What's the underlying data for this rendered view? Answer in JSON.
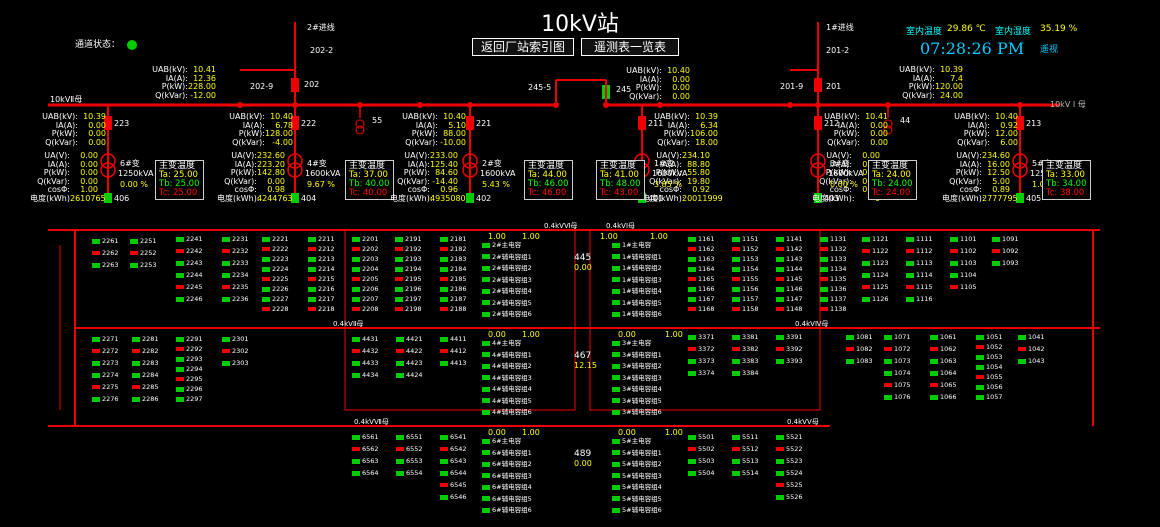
{
  "header": {
    "title": "10kV站",
    "channel_label": "通道状态：",
    "btn_back": "返回厂站索引图",
    "btn_tele": "遥测表一览表",
    "indoor_temp_label": "室内温度",
    "indoor_temp": "29.86 ℃",
    "indoor_hum_label": "室内湿度",
    "indoor_hum": "35.19 %",
    "time": "07:28:26 PM",
    "mode": "遥视"
  },
  "colors": {
    "busbar": "#e00000",
    "closed": "#00cc00",
    "text_value": "#ffff00"
  },
  "lines": {
    "in2": "2#进线",
    "in1": "1#进线",
    "b2022": "202-2",
    "b2012": "201-2",
    "b202": "202",
    "b2029": "202-9",
    "b201": "201",
    "b2019": "201-9",
    "b245": "245",
    "b2455": "245-5",
    "bus2": "10kVⅡ母",
    "bus1": "10kV I 母"
  },
  "incomer_left": {
    "rows": [
      [
        "UAB(kV):",
        "10.41"
      ],
      [
        "IA(A):",
        "12.36"
      ],
      [
        "P(kW):",
        "228.00"
      ],
      [
        "Q(kVar):",
        "-12.00"
      ]
    ]
  },
  "incomer_right": {
    "rows": [
      [
        "UAB(kV):",
        "10.39"
      ],
      [
        "IA(A):",
        "7.4"
      ],
      [
        "P(kW):",
        "120.00"
      ],
      [
        "Q(kVar):",
        "24.00"
      ]
    ]
  },
  "tie": {
    "rows": [
      [
        "UAB(kV):",
        "10.40"
      ],
      [
        "IA(A):",
        "0.00"
      ],
      [
        "P(kW):",
        "0.00"
      ],
      [
        "Q(kVar):",
        "0.00"
      ]
    ]
  },
  "feeders": [
    {
      "id": "223",
      "rows": [
        [
          "UAB(kV):",
          "10.39"
        ],
        [
          "IA(A):",
          "0.00"
        ],
        [
          "P(kW):",
          "0.00"
        ],
        [
          "Q(kVar):",
          "0.00"
        ]
      ],
      "rows2": [
        [
          "UA(V):",
          "0.00"
        ],
        [
          "IA(A):",
          "0.00"
        ],
        [
          "P(kW):",
          "0.00"
        ],
        [
          "Q(kVar):",
          "0.00"
        ],
        [
          "cosΦ:",
          "1.00"
        ],
        [
          "电度(kWh)",
          "2610765"
        ]
      ],
      "xf": "6#变",
      "kva": "1250kVA",
      "load": "0.00 %",
      "low": "406",
      "ta": "25.00",
      "tb": "25.00",
      "tc": "25.00"
    },
    {
      "id": "222",
      "rows": [
        [
          "UAB(kV):",
          "10.40"
        ],
        [
          "IA(A):",
          "6.78"
        ],
        [
          "P(kW):",
          "128.00"
        ],
        [
          "Q(kVar):",
          "-4.00"
        ]
      ],
      "rows2": [
        [
          "UA(V):",
          "232.60"
        ],
        [
          "IA(A):",
          "223.20"
        ],
        [
          "P(kW):",
          "142.80"
        ],
        [
          "Q(kVar):",
          "0.00"
        ],
        [
          "cosΦ:",
          "0.98"
        ],
        [
          "电度(kWh):",
          "4244763"
        ]
      ],
      "xf": "4#变",
      "kva": "1600kVA",
      "load": "9.67 %",
      "low": "404",
      "ta": "37.00",
      "tb": "40.00",
      "tc": "40.00"
    },
    {
      "id": "221",
      "rows": [
        [
          "UAB(kV):",
          "10.40"
        ],
        [
          "IA(A):",
          "5.10"
        ],
        [
          "P(kW):",
          "88.00"
        ],
        [
          "Q(kVar):",
          "-10.00"
        ]
      ],
      "rows2": [
        [
          "UA(V):",
          "233.00"
        ],
        [
          "IA(A):",
          "125.40"
        ],
        [
          "P(kW):",
          "84.60"
        ],
        [
          "Q(kVar):",
          "-14.40"
        ],
        [
          "cosΦ:",
          "0.96"
        ],
        [
          "电度(kWh):",
          "4935080"
        ]
      ],
      "xf": "2#变",
      "kva": "1600kVA",
      "load": "5.43 %",
      "low": "402",
      "ta": "44.00",
      "tb": "46.00",
      "tc": "46.00"
    },
    {
      "id": "211",
      "rows": [
        [
          "UAB(kV):",
          "10.39"
        ],
        [
          "IA(A):",
          "6.34"
        ],
        [
          "P(kW):",
          "106.00"
        ],
        [
          "Q(kVar):",
          "18.00"
        ]
      ],
      "rows2": [
        [
          "UA(V):",
          "234.10"
        ],
        [
          "IA(A):",
          "88.80"
        ],
        [
          "P(kW):",
          "55.80"
        ],
        [
          "Q(kVar):",
          "19.80"
        ],
        [
          "cosΦ:",
          "0.92"
        ],
        [
          "电度(kWh):",
          "20011999"
        ]
      ],
      "xf": "1#变",
      "kva": "1600kVA",
      "load": "3.85 %",
      "low": "401",
      "ta": "41.00",
      "tb": "48.00",
      "tc": "43.00"
    },
    {
      "id": "212",
      "rows": [
        [
          "UAB(kV):",
          "10.41"
        ],
        [
          "IA(A):",
          "0.00"
        ],
        [
          "P(kW):",
          "0.00"
        ],
        [
          "Q(kVar):",
          "0.00"
        ]
      ],
      "rows2": [
        [
          "UA(V):",
          "0.00"
        ],
        [
          "IA(A):",
          "0.00"
        ],
        [
          "P(kW):",
          "0.00"
        ],
        [
          "Q(kVar):",
          "0.00"
        ],
        [
          "cosΦ:",
          "0.00"
        ],
        [
          "电度(kWh):",
          "0"
        ]
      ],
      "xf": "3#变",
      "kva": "1600kVA",
      "load": "0.00 %",
      "low": "403",
      "ta": "24.00",
      "tb": "24.00",
      "tc": "24.00"
    },
    {
      "id": "213",
      "rows": [
        [
          "UAB(kV):",
          "10.40"
        ],
        [
          "IA(A):",
          "0.92"
        ],
        [
          "P(kW):",
          "12.00"
        ],
        [
          "Q(kVar):",
          "6.00"
        ]
      ],
      "rows2": [
        [
          "UA(V):",
          "234.60"
        ],
        [
          "IA(A):",
          "16.00"
        ],
        [
          "P(kW):",
          "12.50"
        ],
        [
          "Q(kVar):",
          "5.00"
        ],
        [
          "cosΦ:",
          "0.89"
        ],
        [
          "电度(kWh):",
          "2777795"
        ]
      ],
      "xf": "5#变",
      "kva": "1250kVA",
      "load": "1.00 %",
      "low": "405",
      "ta": "33.00",
      "tb": "34.00",
      "tc": "38.00"
    }
  ],
  "misc": {
    "n55": "55",
    "n44": "44",
    "temp_title": "主变温度",
    "ta": "Ta:",
    "tb": "Tb:",
    "tc": "Tc:"
  },
  "lowbus": {
    "b4kvI": "0.4kVⅠ母",
    "b4kvII": "0.4kVⅡ母",
    "b4kvIII": "0.4kVⅢ母",
    "b4kvIV": "0.4kVⅣ母",
    "b4kvV": "0.4kVⅤ母",
    "b4kvVI": "0.4kVⅥ母",
    "b4kvVII": "0.4kVⅦ母",
    "s445": "445",
    "v445": "0.00",
    "s467": "467",
    "v467": "12.15",
    "s489": "489",
    "v489": "0.00"
  },
  "ties": [
    [
      "1.00",
      "1.00",
      "1.00",
      "1.00"
    ],
    [
      "0.00",
      "1.00",
      "0.00",
      "1.00"
    ],
    [
      "0.00",
      "1.00",
      "0.00",
      "1.00"
    ]
  ],
  "col_labels": {
    "c1": [
      "2261",
      "2262",
      "2263"
    ],
    "c2": [
      "2251",
      "2252",
      "2253"
    ],
    "c3": [
      "2241",
      "2242",
      "2243",
      "2244",
      "2245",
      "2246"
    ],
    "c4": [
      "2231",
      "2232",
      "2233",
      "2234",
      "2235",
      "2236"
    ],
    "c5": [
      "2221",
      "2222",
      "2223",
      "2224",
      "2225",
      "2226",
      "2227",
      "2228"
    ],
    "c6": [
      "2211",
      "2212",
      "2213",
      "2214",
      "2215",
      "2216",
      "2217",
      "2218"
    ],
    "c7": [
      "2201",
      "2202",
      "2203",
      "2204",
      "2205",
      "2206",
      "2207",
      "2208"
    ],
    "c8": [
      "2191",
      "2192",
      "2193",
      "2194",
      "2195",
      "2196",
      "2197",
      "2198"
    ],
    "c9": [
      "2181",
      "2182",
      "2183",
      "2184",
      "2185",
      "2186",
      "2187",
      "2188"
    ],
    "r1": [
      "1161",
      "1162",
      "1163",
      "1164",
      "1165",
      "1166",
      "1167",
      "1168"
    ],
    "r2": [
      "1151",
      "1152",
      "1153",
      "1154",
      "1155",
      "1156",
      "1157",
      "1158"
    ],
    "r3": [
      "1141",
      "1142",
      "1143",
      "1144",
      "1145",
      "1146",
      "1147",
      "1148"
    ],
    "r4": [
      "1131",
      "1132",
      "1133",
      "1134",
      "1135",
      "1136",
      "1137",
      "1138"
    ],
    "r5": [
      "1121",
      "1122",
      "1123",
      "1124",
      "1125",
      "1126"
    ],
    "r6": [
      "1111",
      "1112",
      "1113",
      "1114",
      "1115",
      "1116"
    ],
    "r7": [
      "1101",
      "1102",
      "1103",
      "1104",
      "1105"
    ],
    "r8": [
      "1091",
      "1092",
      "1093"
    ],
    "m1": [
      "2271",
      "2272",
      "2273",
      "2274",
      "2275",
      "2276"
    ],
    "m2": [
      "2281",
      "2282",
      "2283",
      "2284",
      "2285",
      "2286"
    ],
    "m3": [
      "2291",
      "2292",
      "2293",
      "2294",
      "2295",
      "2296",
      "2297"
    ],
    "m4": [
      "2301",
      "2302",
      "2303"
    ],
    "m5": [
      "4431",
      "4432",
      "4433",
      "4434"
    ],
    "m6": [
      "4421",
      "4422",
      "4423",
      "4424"
    ],
    "m7": [
      "4411",
      "4412",
      "4413"
    ],
    "n1": [
      "3371",
      "3372",
      "3373",
      "3374"
    ],
    "n2": [
      "3381",
      "3382",
      "3383",
      "3384"
    ],
    "n3": [
      "3391",
      "3392",
      "3393"
    ],
    "n4": [
      "1081",
      "1082",
      "1083"
    ],
    "n5": [
      "1071",
      "1072",
      "1073",
      "1074",
      "1075",
      "1076"
    ],
    "n6": [
      "1061",
      "1062",
      "1063",
      "1064",
      "1065",
      "1066"
    ],
    "n7": [
      "1051",
      "1052",
      "1053",
      "1054",
      "1055",
      "1056",
      "1057"
    ],
    "n8": [
      "1041",
      "1042",
      "1043"
    ],
    "b1": [
      "6561",
      "6562",
      "6563",
      "6564"
    ],
    "b2": [
      "6551",
      "6552",
      "6553",
      "6554"
    ],
    "b3": [
      "6541",
      "6542",
      "6543",
      "6544",
      "6545",
      "6546"
    ],
    "b4": [
      "5501",
      "5502",
      "5503",
      "5504"
    ],
    "b5": [
      "5511",
      "5512",
      "5513",
      "5514"
    ],
    "b6": [
      "5521",
      "5522",
      "5523",
      "5524",
      "5525",
      "5526"
    ]
  },
  "cap_rows": {
    "left": [
      "2#主电容",
      "2#辅电容组1",
      "2#辅电容组2",
      "2#辅电容组3",
      "2#辅电容组4",
      "2#辅电容组5",
      "2#辅电容组6"
    ],
    "right": [
      "1#主电容",
      "1#辅电容组1",
      "1#辅电容组2",
      "1#辅电容组3",
      "1#辅电容组4",
      "1#辅电容组5",
      "1#辅电容组6"
    ],
    "mleft": [
      "4#主电容",
      "4#辅电容组1",
      "4#辅电容组2",
      "4#辅电容组3",
      "4#辅电容组4",
      "4#辅电容组5",
      "4#辅电容组6"
    ],
    "mright": [
      "3#主电容",
      "3#辅电容组1",
      "3#辅电容组2",
      "3#辅电容组3",
      "3#辅电容组4",
      "3#辅电容组5",
      "3#辅电容组6"
    ],
    "bleft": [
      "6#主电容",
      "6#辅电容组1",
      "6#辅电容组2",
      "6#辅电容组3",
      "6#辅电容组4",
      "6#辅电容组5",
      "6#辅电容组6"
    ],
    "bright": [
      "5#主电容",
      "5#辅电容组1",
      "5#辅电容组2",
      "5#辅电容组3",
      "5#辅电容组4",
      "5#辅电容组5",
      "5#辅电容组6"
    ]
  }
}
